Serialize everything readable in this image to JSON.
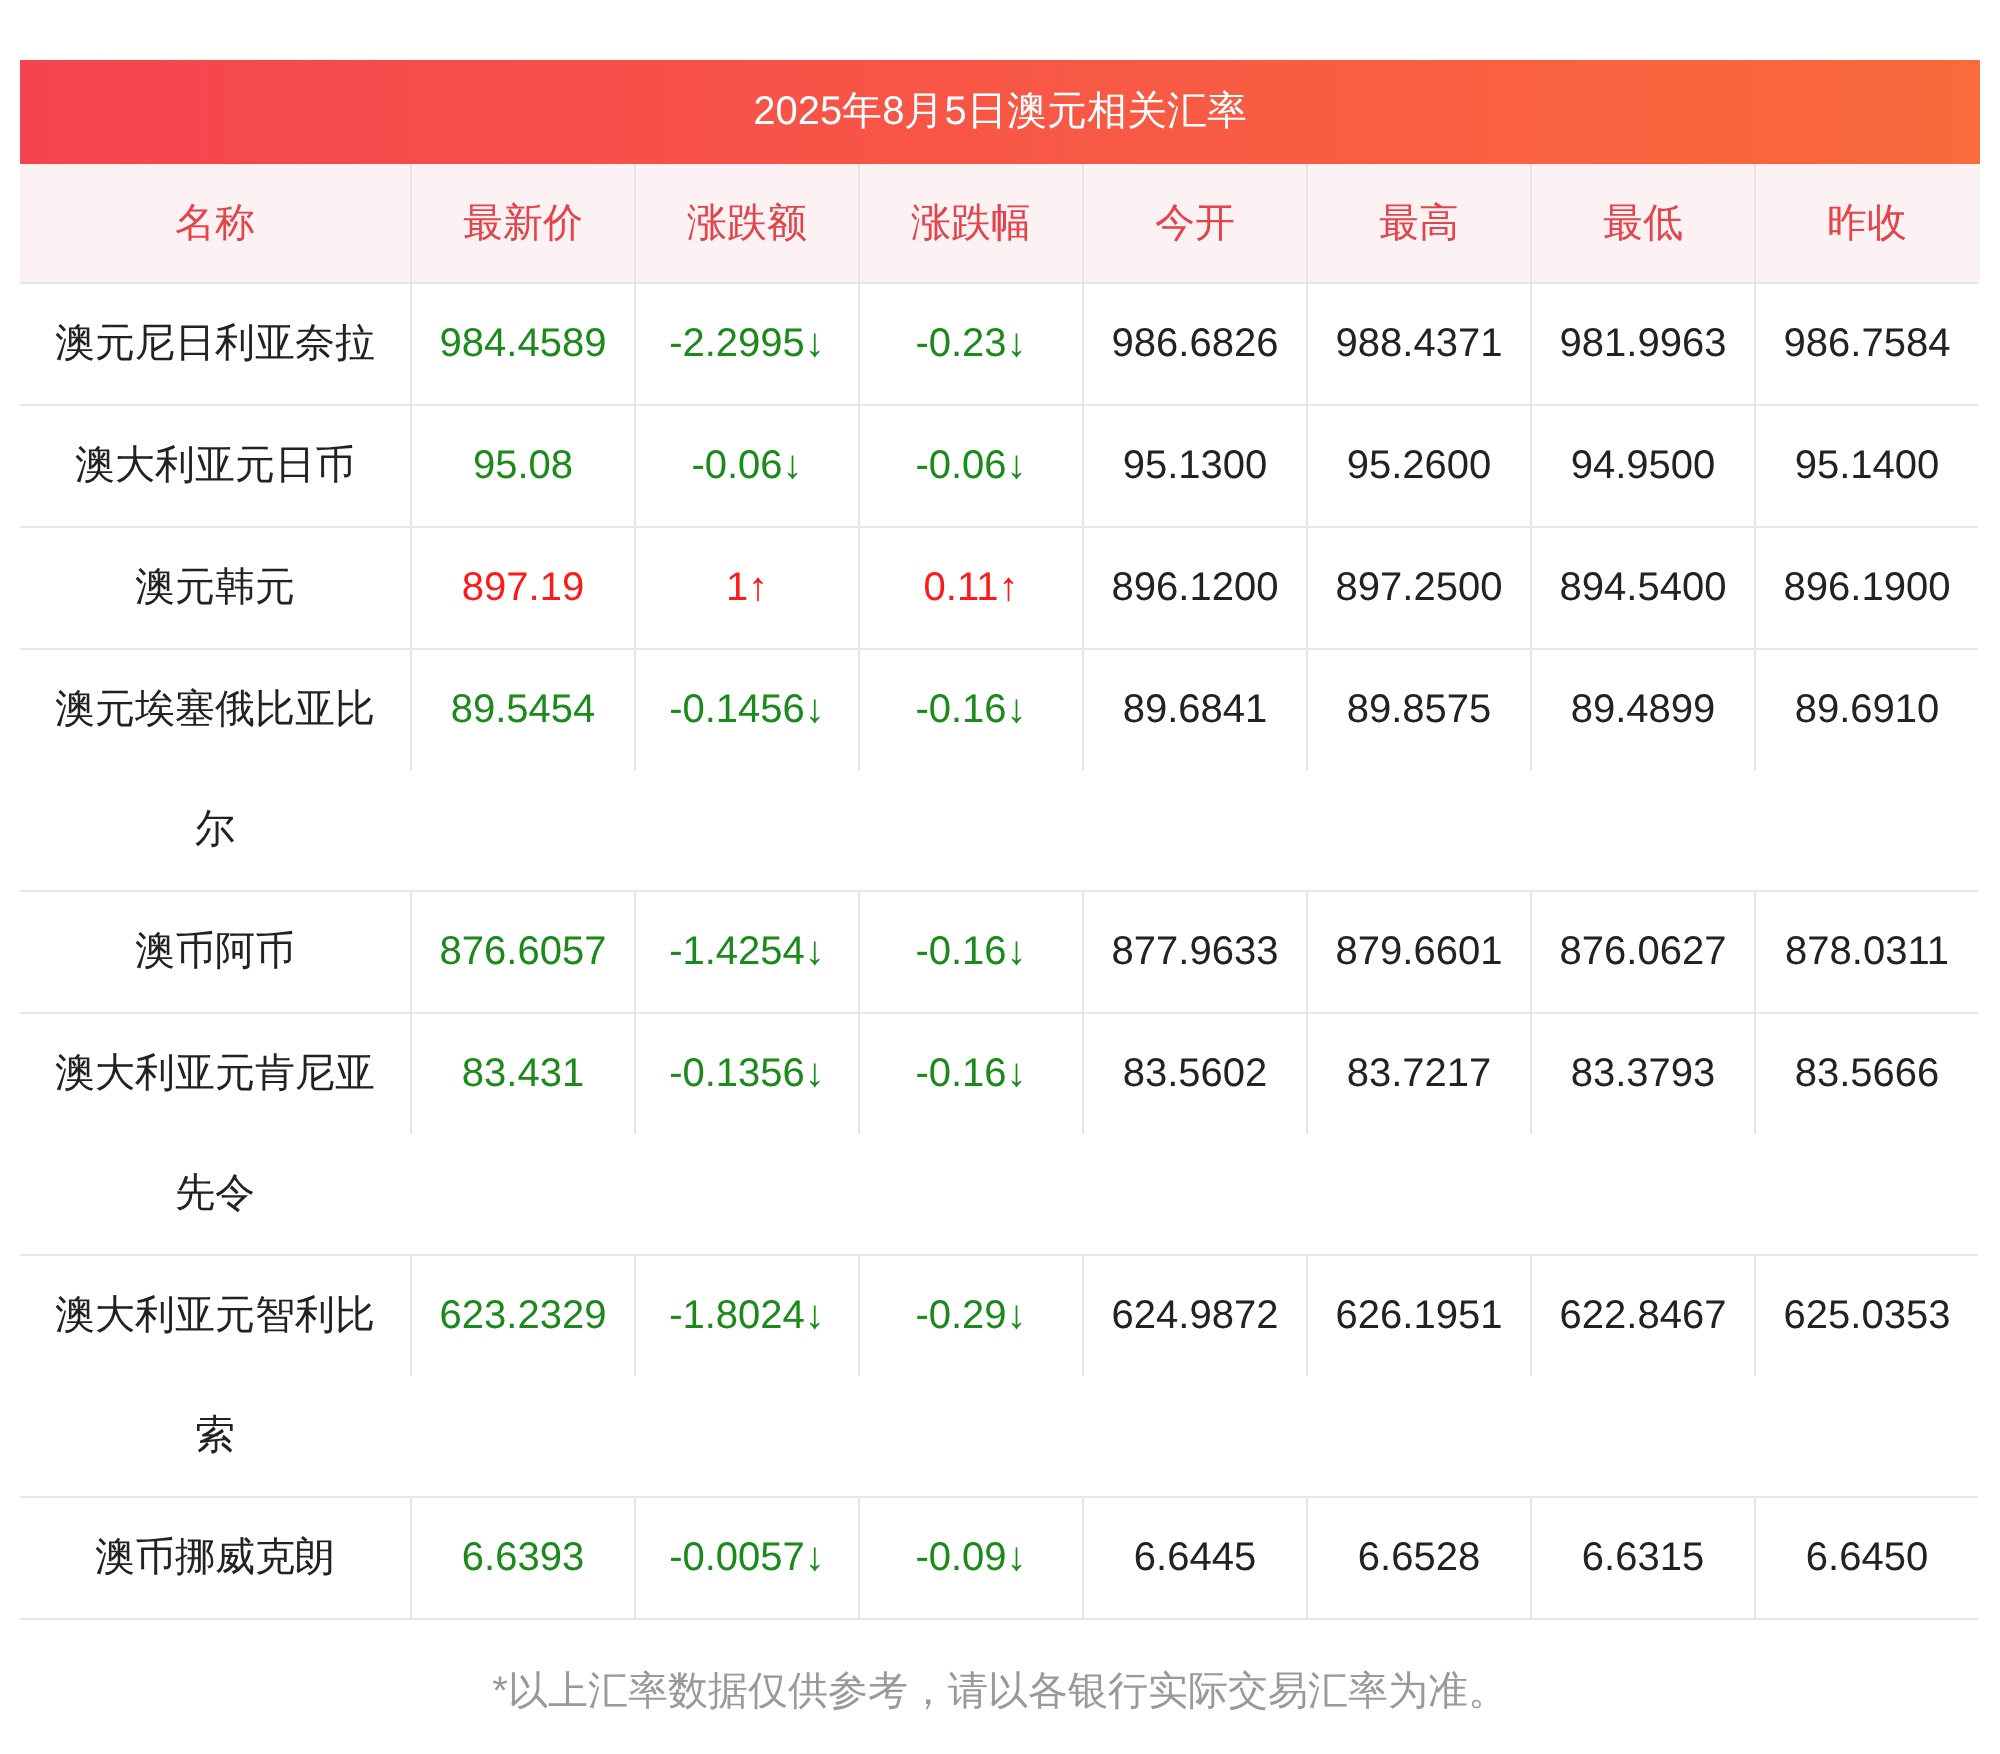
{
  "title": "2025年8月5日澳元相关汇率",
  "columns": [
    "名称",
    "最新价",
    "涨跌额",
    "涨跌幅",
    "今开",
    "最高",
    "最低",
    "昨收"
  ],
  "rows": [
    {
      "name": "澳元尼日利亚奈拉",
      "color": "#1a8a1a",
      "price": "984.4589",
      "change": "-2.2995↓",
      "pct": "-0.23↓",
      "open": "986.6826",
      "high": "988.4371",
      "low": "981.9963",
      "prev": "986.7584"
    },
    {
      "name": "澳大利亚元日币",
      "color": "#1a8a1a",
      "price": "95.08",
      "change": "-0.06↓",
      "pct": "-0.06↓",
      "open": "95.1300",
      "high": "95.2600",
      "low": "94.9500",
      "prev": "95.1400"
    },
    {
      "name": "澳元韩元",
      "color": "#ff1a1a",
      "price": "897.19",
      "change": "1↑",
      "pct": "0.11↑",
      "open": "896.1200",
      "high": "897.2500",
      "low": "894.5400",
      "prev": "896.1900"
    },
    {
      "name": "澳元埃塞俄比亚比尔",
      "color": "#1a8a1a",
      "price": "89.5454",
      "change": "-0.1456↓",
      "pct": "-0.16↓",
      "open": "89.6841",
      "high": "89.8575",
      "low": "89.4899",
      "prev": "89.6910"
    },
    {
      "name": "澳币阿币",
      "color": "#1a8a1a",
      "price": "876.6057",
      "change": "-1.4254↓",
      "pct": "-0.16↓",
      "open": "877.9633",
      "high": "879.6601",
      "low": "876.0627",
      "prev": "878.0311"
    },
    {
      "name": "澳大利亚元肯尼亚先令",
      "color": "#1a8a1a",
      "price": "83.431",
      "change": "-0.1356↓",
      "pct": "-0.16↓",
      "open": "83.5602",
      "high": "83.7217",
      "low": "83.3793",
      "prev": "83.5666"
    },
    {
      "name": "澳大利亚元智利比索",
      "color": "#1a8a1a",
      "price": "623.2329",
      "change": "-1.8024↓",
      "pct": "-0.29↓",
      "open": "624.9872",
      "high": "626.1951",
      "low": "622.8467",
      "prev": "625.0353"
    },
    {
      "name": "澳币挪威克朗",
      "color": "#1a8a1a",
      "price": "6.6393",
      "change": "-0.0057↓",
      "pct": "-0.09↓",
      "open": "6.6445",
      "high": "6.6528",
      "low": "6.6315",
      "prev": "6.6450"
    }
  ],
  "footnote": "*以上汇率数据仅供参考，请以各银行实际交易汇率为准。"
}
